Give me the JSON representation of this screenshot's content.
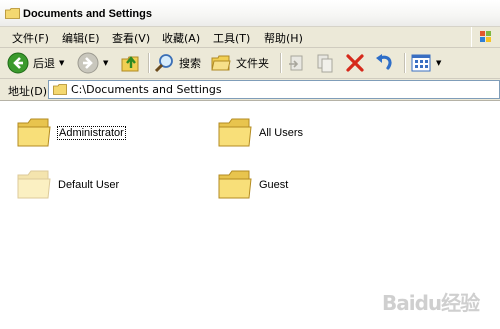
{
  "window": {
    "title": "Documents and Settings"
  },
  "menu": {
    "items": [
      {
        "label": "文件(F)"
      },
      {
        "label": "编辑(E)"
      },
      {
        "label": "查看(V)"
      },
      {
        "label": "收藏(A)"
      },
      {
        "label": "工具(T)"
      },
      {
        "label": "帮助(H)"
      }
    ]
  },
  "toolbar": {
    "back_label": "后退",
    "search_label": "搜索",
    "folders_label": "文件夹"
  },
  "address": {
    "label": "地址(D)",
    "value": "C:\\Documents and Settings"
  },
  "folders": [
    {
      "name": "Administrator",
      "focused": true
    },
    {
      "name": "All Users",
      "focused": false
    },
    {
      "name": "Default User",
      "focused": false,
      "faded": true
    },
    {
      "name": "Guest",
      "focused": false
    }
  ],
  "watermark": {
    "text": "Baidu经验"
  },
  "colors": {
    "folder_yellow": "#f5dc6e",
    "menu_bg": "#ece9d8",
    "address_border": "#7f9db9"
  }
}
